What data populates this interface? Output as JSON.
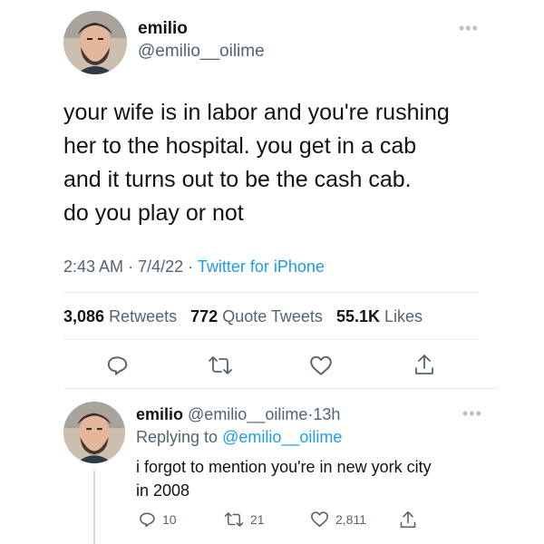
{
  "tweet": {
    "author_name": "emilio",
    "author_handle": "@emilio__oilime",
    "more_icon": "more-dots-icon",
    "text_lines": [
      "your wife is in labor and you're rushing",
      "her to the hospital. you get in a cab",
      "and it turns out to be the cash cab.",
      "do you play or not"
    ],
    "time": "2:43 AM",
    "date": "7/4/22",
    "separator": "·",
    "source": "Twitter for iPhone",
    "retweets_count": "3,086",
    "retweets_label": "Retweets",
    "quotes_count": "772",
    "quotes_label": "Quote Tweets",
    "likes_count": "55.1K",
    "likes_label": "Likes",
    "actions": [
      "reply-icon",
      "retweet-icon",
      "like-icon",
      "share-icon"
    ]
  },
  "reply": {
    "author_name": "emilio",
    "author_handle": "@emilio__oilime",
    "time_ago": "13h",
    "separator": "·",
    "replying_to_label": "Replying to",
    "replying_to_handle": "@emilio__oilime",
    "text_lines": [
      "i forgot to mention you're in new york city",
      "in 2008"
    ],
    "reply_count": "10",
    "retweet_count": "21",
    "like_count": "2,811"
  },
  "colors": {
    "text": "#0f1419",
    "secondary": "#536471",
    "accent": "#1d9bf0",
    "divider": "#e6ecf0"
  }
}
